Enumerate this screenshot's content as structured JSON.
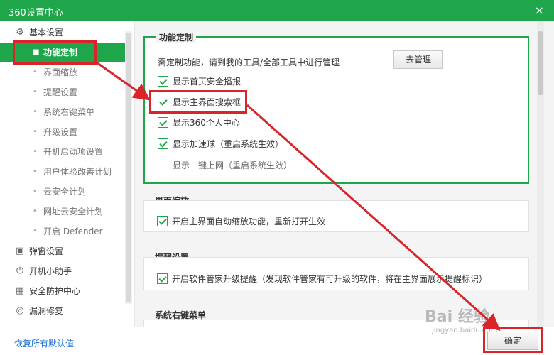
{
  "window": {
    "title": "360设置中心",
    "close_icon": "×"
  },
  "sidebar": {
    "items": [
      {
        "label": "基本设置",
        "icon": "gear-icon",
        "glyph": "⚙"
      },
      {
        "label": "功能定制",
        "active": true
      },
      {
        "label": "界面缩放"
      },
      {
        "label": "提醒设置"
      },
      {
        "label": "系统右键菜单"
      },
      {
        "label": "升级设置"
      },
      {
        "label": "开机启动项设置"
      },
      {
        "label": "用户体验改善计划"
      },
      {
        "label": "云安全计划"
      },
      {
        "label": "网址云安全计划"
      },
      {
        "label": "开启 Defender"
      },
      {
        "label": "弹窗设置",
        "icon": "popup-icon",
        "glyph": "▣"
      },
      {
        "label": "开机小助手",
        "icon": "power-icon",
        "glyph": "⏻"
      },
      {
        "label": "安全防护中心",
        "icon": "shield-grid-icon",
        "glyph": "▦"
      },
      {
        "label": "漏洞修复",
        "icon": "repair-icon",
        "glyph": "◎"
      }
    ]
  },
  "feature_section": {
    "title": "功能定制",
    "description": "需定制功能，请到我的工具/全部工具中进行管理",
    "manage_button": "去管理",
    "options": [
      {
        "label": "显示首页安全播报",
        "checked": true
      },
      {
        "label": "显示主界面搜索框",
        "checked": true
      },
      {
        "label": "显示360个人中心",
        "checked": true
      },
      {
        "label": "显示加速球（重启系统生效）",
        "checked": true
      },
      {
        "label": "显示一键上网（重启系统生效）",
        "checked": false
      }
    ]
  },
  "zoom_section": {
    "title": "界面缩放",
    "option": {
      "label": "开启主界面自动缩放功能，重新打开生效",
      "checked": true
    }
  },
  "reminder_section": {
    "title": "提醒设置",
    "option": {
      "label": "开启软件管家升级提醒（发现软件管家有可升级的软件，将在主界面展示提醒标识）",
      "checked": true
    }
  },
  "context_menu_section": {
    "title": "系统右键菜单"
  },
  "footer": {
    "reset_link": "恢复所有默认值",
    "ok_button": "确定"
  },
  "watermark": {
    "text": "Bai 经验",
    "sub": "jingyan.baidu.com"
  },
  "colors": {
    "brand_green": "#1fa64a",
    "annotation_red": "#d9252a",
    "link_blue": "#1a6fd6"
  }
}
